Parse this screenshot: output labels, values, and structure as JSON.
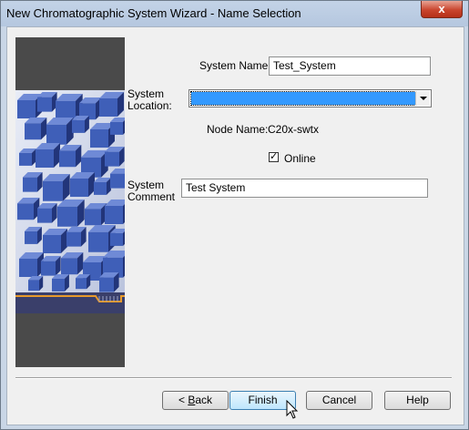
{
  "window": {
    "title": "New Chromatographic System Wizard - Name Selection",
    "close_glyph": "x"
  },
  "form": {
    "system_name_label": "System Name:",
    "system_name_value": "Test_System",
    "system_location_label_line1": "System",
    "system_location_label_line2": "Location:",
    "system_location_value": "",
    "node_name_label": "Node Name:",
    "node_name_value": "C20x-swtx",
    "online_label": "Online",
    "online_checked": true,
    "online_check_glyph": "✓",
    "system_comment_label_line1": "System",
    "system_comment_label_line2": "Comment",
    "system_comment_value": "Test System"
  },
  "buttons": {
    "back": {
      "prefix": "< ",
      "mnemonic": "B",
      "rest": "ack"
    },
    "finish": "Finish",
    "cancel": "Cancel",
    "help": "Help"
  },
  "colors": {
    "accent": "#3399ff",
    "art_blue": "#3f5fb8",
    "art_orange": "#e89a2c"
  }
}
